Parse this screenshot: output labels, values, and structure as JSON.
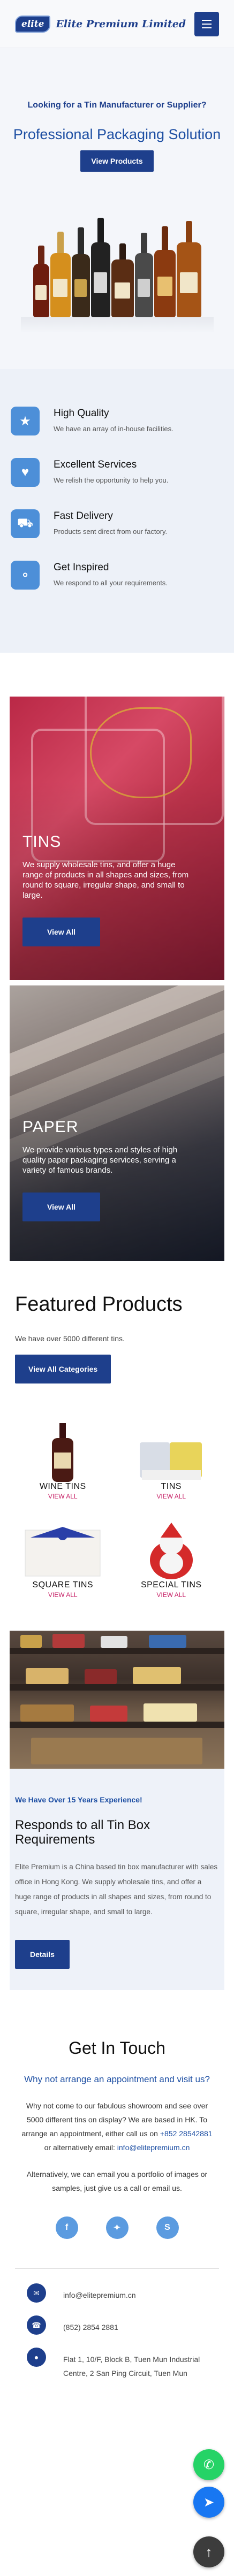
{
  "header": {
    "logo_badge": "elite",
    "logo_text": "Elite Premium Limited"
  },
  "hero": {
    "kicker": "Looking for a Tin Manufacturer or Supplier?",
    "title": "Professional Packaging Solution",
    "button": "View Products"
  },
  "features": [
    {
      "icon": "certificate-icon",
      "title": "High Quality",
      "text": "We have an array of in-house facilities."
    },
    {
      "icon": "handshake-icon",
      "title": "Excellent Services",
      "text": "We relish the opportunity to help you."
    },
    {
      "icon": "truck-icon",
      "title": "Fast Delivery",
      "text": "Products sent direct from our factory."
    },
    {
      "icon": "lightbulb-icon",
      "title": "Get Inspired",
      "text": "We respond to all your requirements."
    }
  ],
  "categories": [
    {
      "title": "TINS",
      "text": "We supply wholesale tins, and offer a huge range of products in all shapes and sizes, from round to square, irregular shape, and small to large.",
      "button": "View All"
    },
    {
      "title": "PAPER",
      "text": "We provide various types and styles of high quality paper packaging services, serving a variety of famous brands.",
      "button": "View All"
    }
  ],
  "featured": {
    "title": "Featured Products",
    "text": "We have over 5000 different tins.",
    "button": "View All Categories",
    "products": [
      {
        "name": "WINE TINS",
        "link": "VIEW ALL"
      },
      {
        "name": "TINS",
        "link": "VIEW ALL"
      },
      {
        "name": "SQUARE TINS",
        "link": "VIEW ALL"
      },
      {
        "name": "SPECIAL TINS",
        "link": "VIEW ALL"
      }
    ]
  },
  "about": {
    "kicker": "We Have Over 15 Years Experience!",
    "title": "Responds to all Tin Box Requirements",
    "text": "Elite Premium is a China based tin box manufacturer with sales office in Hong Kong. We supply wholesale tins, and offer a huge range of products in all shapes and sizes, from round to square, irregular shape, and small to large.",
    "button": "Details"
  },
  "contact": {
    "title": "Get In Touch",
    "subtitle": "Why not arrange an appointment and visit us?",
    "p1_a": "Why not come to our fabulous showroom and see over 5000 different tins on display? We are based in HK. To arrange an appointment, either call us on",
    "phone_link": "+852 28542881",
    "p1_b": "or alternatively email:",
    "email_link": "info@elitepremium.cn",
    "p2": "Alternatively, we can email you a portfolio of images or samples, just give us a call or email us.",
    "socials": [
      "facebook-icon",
      "twitter-icon",
      "skype-icon"
    ],
    "list": [
      {
        "icon": "envelope-icon",
        "text": "info@elitepremium.cn"
      },
      {
        "icon": "phone-icon",
        "text": "(852) 2854 2881"
      },
      {
        "icon": "map-marker-icon",
        "text": "Flat 1, 10/F, Block B, Tuen Mun Industrial Centre, 2 San Ping Circuit, Tuen Mun"
      }
    ]
  },
  "floating": [
    "whatsapp-icon",
    "messenger-icon",
    "arrow-up-icon"
  ],
  "colors": {
    "brand": "#1e3f8c",
    "accent": "#4d8fd8",
    "link_pink": "#c8266a"
  }
}
